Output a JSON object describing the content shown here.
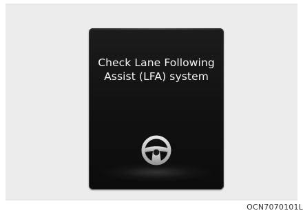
{
  "display": {
    "message_line1": "Check Lane Following",
    "message_line2": "Assist (LFA) system",
    "icon": "steering-wheel-icon"
  },
  "caption": {
    "code": "OCN7070101L"
  }
}
